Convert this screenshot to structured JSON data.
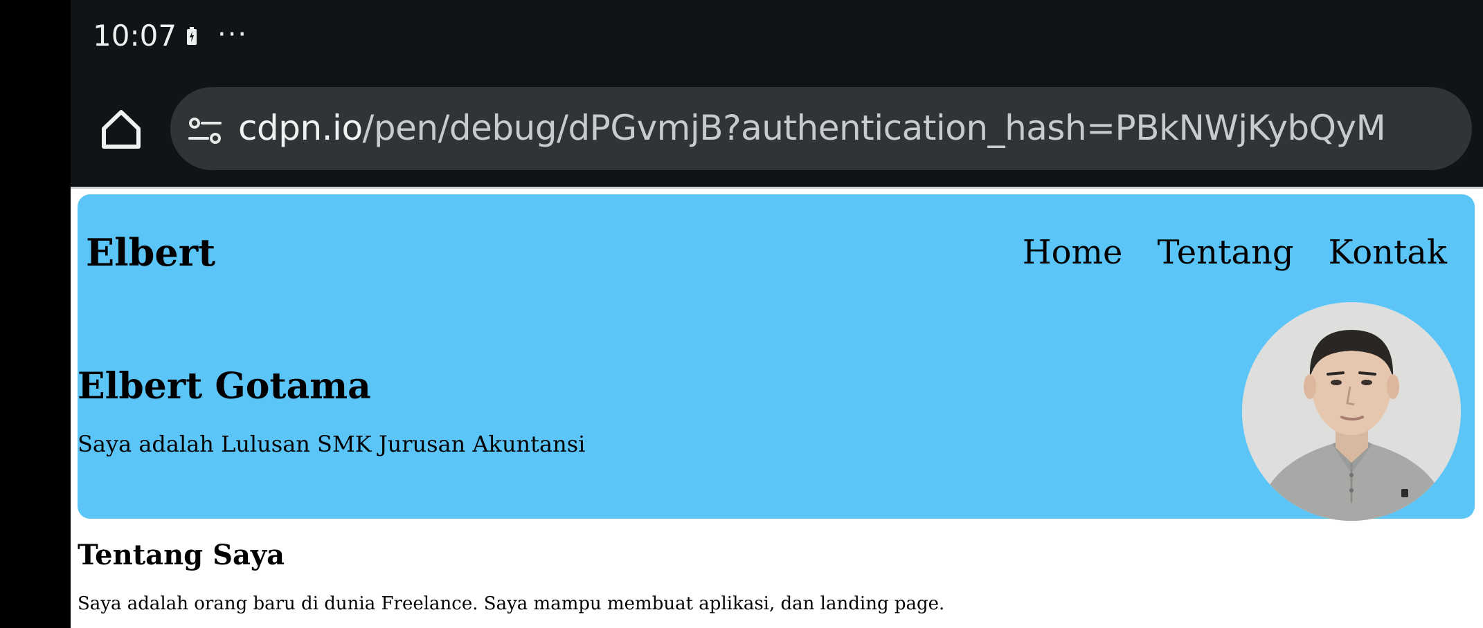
{
  "status_bar": {
    "time": "10:07",
    "more_indicator": "···",
    "battery_icon": "battery-charging-icon"
  },
  "browser": {
    "home_icon": "home-icon",
    "site_info_icon": "site-settings-icon",
    "url_domain": "cdpn.io",
    "url_path": "/pen/debug/dPGvmjB?authentication_hash=PBkNWjKybQyM"
  },
  "page": {
    "brand": "Elbert",
    "nav": {
      "items": [
        {
          "label": "Home"
        },
        {
          "label": "Tentang"
        },
        {
          "label": "Kontak"
        }
      ]
    },
    "hero": {
      "name": "Elbert Gotama",
      "tagline": "Saya adalah Lulusan SMK Jurusan Akuntansi",
      "background_color": "#5bc5f8"
    },
    "about": {
      "heading": "Tentang Saya",
      "text": "Saya adalah orang baru di dunia Freelance. Saya mampu membuat aplikasi, dan landing page."
    }
  }
}
